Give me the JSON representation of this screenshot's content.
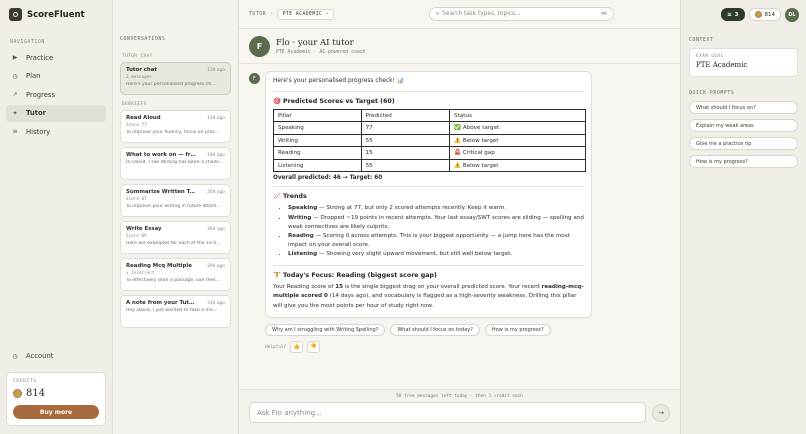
{
  "app": {
    "name": "ScoreFluent"
  },
  "sidebar": {
    "nav_label": "NAVIGATION",
    "items": [
      {
        "label": "Practice",
        "icon": "▶"
      },
      {
        "label": "Plan",
        "icon": "◷"
      },
      {
        "label": "Progress",
        "icon": "↗"
      },
      {
        "label": "Tutor",
        "icon": "✦"
      },
      {
        "label": "History",
        "icon": "≡"
      }
    ],
    "account": {
      "label": "Account",
      "icon": "◷"
    },
    "credits": {
      "label": "CREDITS",
      "value": "814",
      "buy_label": "Buy more"
    }
  },
  "topbar": {
    "crumb_root": "TUTOR",
    "crumb_current": "PTE ACADEMIC",
    "search_placeholder": "Search task types, topics...",
    "search_shortcut": "⌘K",
    "streak": "3",
    "credits": "814",
    "user_initials": "DL"
  },
  "conversations": {
    "heading": "CONVERSATIONS",
    "tutor_group": "TUTOR CHAT",
    "debrief_group": "DEBRIEFS",
    "tutor_chat": {
      "title": "Tutor chat",
      "date": "13d ago",
      "sub": "3 messages",
      "preview": "Here's your personalised progress ch..."
    },
    "debriefs": [
      {
        "title": "Read Aloud",
        "date": "13d ago",
        "sub": "Score 77",
        "preview": "To improve your fluency, focus on prac..."
      },
      {
        "title": "What to work on — from yo...",
        "date": "18d ago",
        "sub": "",
        "preview": "Hi David, I see Writing has been a challenging..."
      },
      {
        "title": "Summarize Written Text",
        "date": "20d ago",
        "sub": "Score 67",
        "preview": "To improve your writing in future attem..."
      },
      {
        "title": "Write Essay",
        "date": "26d ago",
        "sub": "Score 69",
        "preview": "Here are examples for each of the 10 ti..."
      },
      {
        "title": "Reading Mcq Multiple",
        "date": "29d ago",
        "sub": "✗ Incorrect",
        "preview": "To effectively skim a passage, use thes..."
      },
      {
        "title": "A note from your Tutor 💙",
        "date": "31d ago",
        "sub": "",
        "preview": "Hey David, I just wanted to take a mo..."
      }
    ]
  },
  "chat": {
    "avatar": "F",
    "title": "Flo · your AI tutor",
    "subtitle": "PTE Academic · AI-powered coach",
    "intro": "Here's your personalised progress check! 📊",
    "scores_heading": "🎯 Predicted Scores vs Target (60)",
    "table_headers": [
      "Pillar",
      "Predicted",
      "Status"
    ],
    "table_rows": [
      [
        "Speaking",
        "77",
        "✅ Above target"
      ],
      [
        "Writing",
        "55",
        "⚠️ Below target"
      ],
      [
        "Reading",
        "15",
        "🚨 Critical gap"
      ],
      [
        "Listening",
        "55",
        "⚠️ Below target"
      ]
    ],
    "overall": "Overall predicted: 46 → Target: 60",
    "trends_heading": "📈 Trends",
    "trends": [
      {
        "pillar": "Speaking",
        "text": " — Strong at 77, but only 2 scored attempts recently. Keep it warm."
      },
      {
        "pillar": "Writing",
        "text": " — Dropped ~19 points in recent attempts. Your last essay/SWT scores are sliding — spelling and weak connectives are likely culprits."
      },
      {
        "pillar": "Reading",
        "text": " — Scoring 0 across attempts. This is your biggest opportunity — a jump here has the most impact on your overall score."
      },
      {
        "pillar": "Listening",
        "text": " — Showing very slight upward movement, but still well below target."
      }
    ],
    "focus_heading": "🏋️ Today's Focus: Reading (biggest score gap)",
    "focus_p1": "Your Reading score of ",
    "focus_b1": "15",
    "focus_p2": " is the single biggest drag on your overall predicted score. Your recent ",
    "focus_b2": "reading-mcq-multiple scored 0",
    "focus_p3": " (14 days ago), and vocabulary is flagged as a high-severity weakness. Drilling this pillar will give you the most points per hour of study right now.",
    "suggestions": [
      "Why am I struggling with Writing Spelling?",
      "What should I focus on today?",
      "How is my progress?"
    ],
    "helpful_label": "Helpful?",
    "free_note": "50 free messages left today · then 1 credit each",
    "input_placeholder": "Ask Flo anything..."
  },
  "context": {
    "heading": "CONTEXT",
    "goal_label": "EXAM GOAL",
    "goal_value": "PTE Academic",
    "prompts_heading": "QUICK PROMPTS",
    "prompts": [
      "What should I focus on?",
      "Explain my weak areas",
      "Give me a practice tip",
      "How is my progress?"
    ]
  }
}
